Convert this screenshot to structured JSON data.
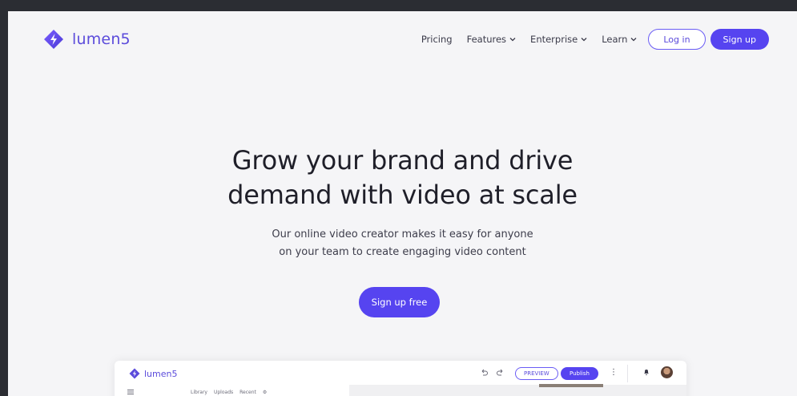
{
  "brand": {
    "name": "lumen5",
    "accent_color": "#5644f0",
    "logo_icon": "lumen5-logo-icon"
  },
  "nav": {
    "items": [
      {
        "label": "Pricing",
        "has_dropdown": false
      },
      {
        "label": "Features",
        "has_dropdown": true
      },
      {
        "label": "Enterprise",
        "has_dropdown": true
      },
      {
        "label": "Learn",
        "has_dropdown": true
      }
    ],
    "login_label": "Log in",
    "signup_label": "Sign up"
  },
  "hero": {
    "title_line1": "Grow your brand and drive",
    "title_line2": "demand with video at scale",
    "subtitle_line1": "Our online video creator makes it easy for anyone",
    "subtitle_line2": "on your team to create engaging video content",
    "cta_label": "Sign up free"
  },
  "app_preview": {
    "logo_text": "lumen5",
    "preview_label": "PREVIEW",
    "publish_label": "Publish",
    "more_label": "⋮",
    "tabs": [
      "Library",
      "Uploads",
      "Recent"
    ]
  }
}
